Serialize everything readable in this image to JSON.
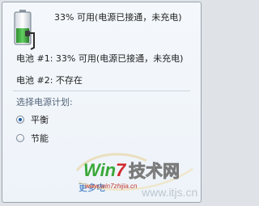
{
  "battery": {
    "summary": "33% 可用(电源已接通，未充电)",
    "battery1": "电池 #1: 33% 可用(电源已接通，未充电)",
    "battery2": "电池 #2: 不存在"
  },
  "power_plan": {
    "title": "选择电源计划:",
    "options": [
      {
        "label": "平衡",
        "selected": true
      },
      {
        "label": "节能",
        "selected": false
      }
    ]
  },
  "footer": {
    "more_link": "更多电"
  },
  "watermark": {
    "brand": "Win7技术网",
    "url1": "www.win7zhijia.cn",
    "url2": "www.itjs.cn",
    "color_green": "#3aa83a",
    "color_red": "#d2282d",
    "color_blue": "#1e55c8"
  },
  "icons": {
    "battery": "battery-plugged-icon"
  }
}
